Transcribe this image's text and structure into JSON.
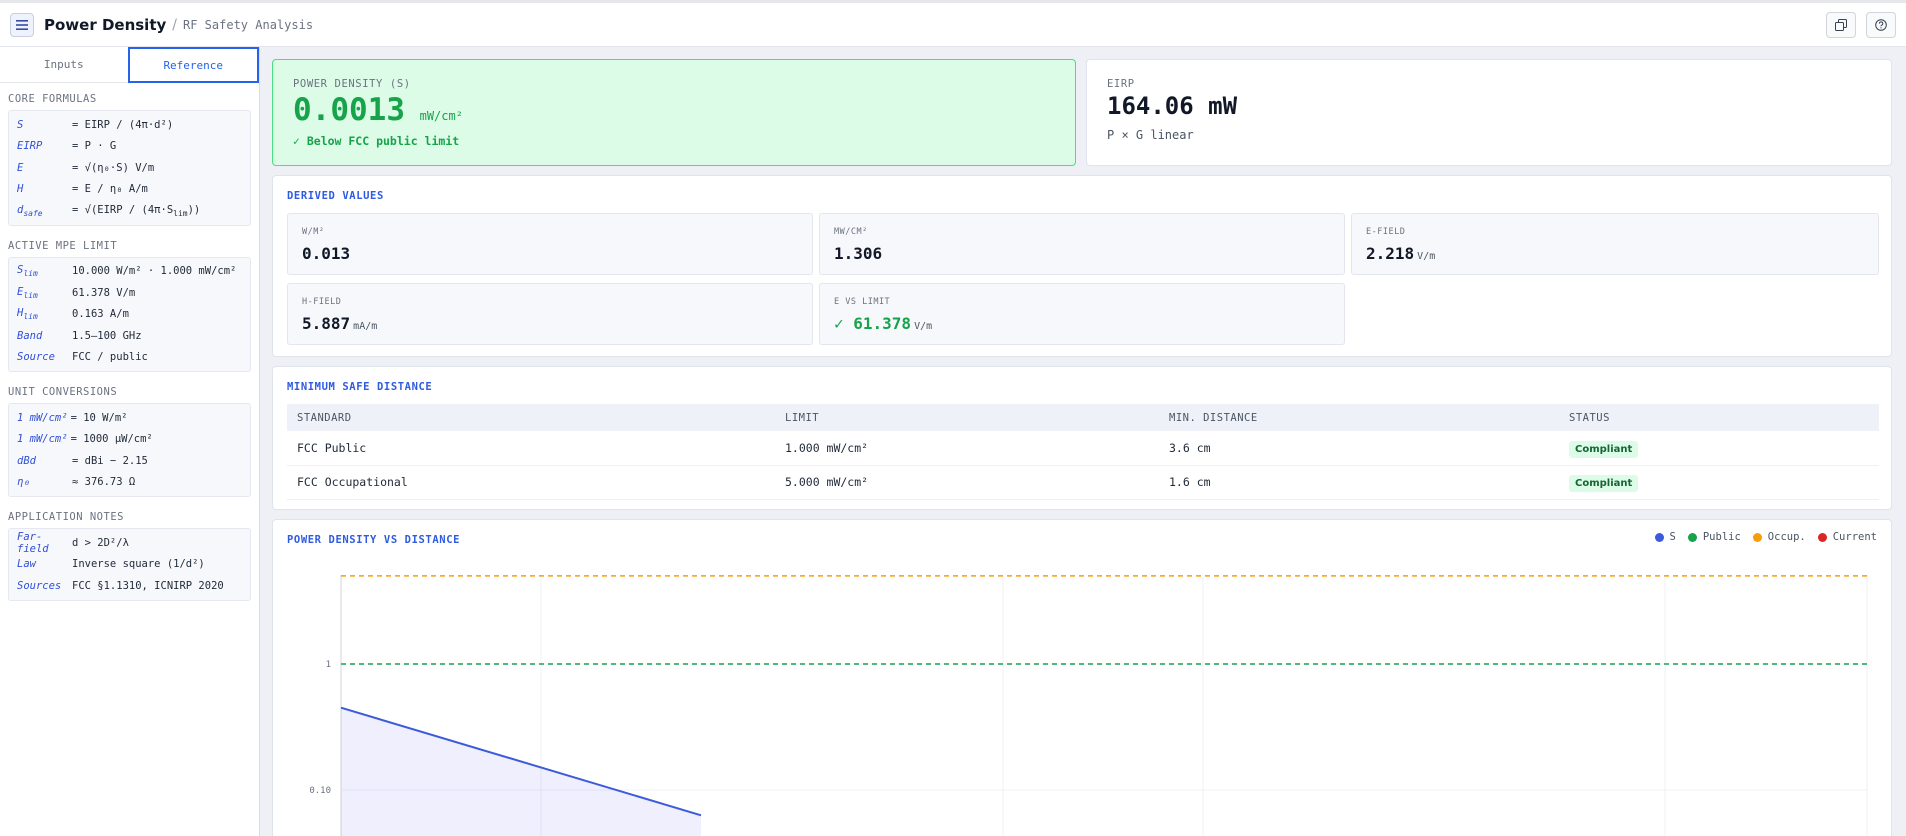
{
  "header": {
    "title": "Power Density",
    "separator": "/",
    "subtitle": "RF Safety Analysis"
  },
  "sidebar": {
    "tabs": [
      {
        "label": "Inputs",
        "active": false
      },
      {
        "label": "Reference",
        "active": true
      }
    ],
    "core_formulas": {
      "title": "CORE FORMULAS",
      "rows": [
        {
          "k": "S",
          "v": "= EIRP / (4π·d²)"
        },
        {
          "k": "EIRP",
          "v": "= P · G"
        },
        {
          "k": "E",
          "v": "= √(η₀·S) V/m"
        },
        {
          "k": "H",
          "v": "= E / η₀ A/m"
        },
        {
          "k_main": "d",
          "k_sub": "safe",
          "v_main": "= √(EIRP / (4π·S",
          "v_sub": "lim",
          "v_end": "))"
        }
      ]
    },
    "mpe_limit": {
      "title": "ACTIVE MPE LIMIT",
      "rows": [
        {
          "k_main": "S",
          "k_sub": "lim",
          "v": "10.000 W/m² · 1.000 mW/cm²"
        },
        {
          "k_main": "E",
          "k_sub": "lim",
          "v": "61.378 V/m"
        },
        {
          "k_main": "H",
          "k_sub": "lim",
          "v": "0.163 A/m"
        },
        {
          "k": "Band",
          "v": "1.5–100 GHz"
        },
        {
          "k": "Source",
          "v": "FCC / public"
        }
      ]
    },
    "conversions": {
      "title": "UNIT CONVERSIONS",
      "rows": [
        {
          "k": "1 mW/cm²",
          "v": "= 10 W/m²"
        },
        {
          "k": "1 mW/cm²",
          "v": "= 1000 µW/cm²"
        },
        {
          "k": "dBd",
          "v": "= dBi − 2.15"
        },
        {
          "k": "η₀",
          "v": "≈ 376.73 Ω"
        }
      ]
    },
    "notes": {
      "title": "APPLICATION NOTES",
      "rows": [
        {
          "k": "Far-field",
          "v": "d > 2D²/λ"
        },
        {
          "k": "Law",
          "v": "Inverse square (1/d²)"
        },
        {
          "k": "Sources",
          "v": "FCC §1.1310, ICNIRP 2020"
        }
      ]
    }
  },
  "power_density": {
    "label": "POWER DENSITY (S)",
    "value": "0.0013",
    "unit": "mW/cm²",
    "status": "✓ Below FCC public limit"
  },
  "eirp": {
    "label": "EIRP",
    "value": "164.06 mW",
    "note": "P × G linear"
  },
  "derived": {
    "title": "DERIVED VALUES",
    "items": [
      {
        "label": "W/M²",
        "value": "0.013",
        "unit": ""
      },
      {
        "label": "MW/CM²",
        "value": "1.306",
        "unit": ""
      },
      {
        "label": "E-FIELD",
        "value": "2.218",
        "unit": "V/m"
      },
      {
        "label": "H-FIELD",
        "value": "5.887",
        "unit": "mA/m"
      },
      {
        "label": "E VS LIMIT",
        "value": "✓ 61.378",
        "unit": "V/m"
      }
    ]
  },
  "min_distance": {
    "title": "MINIMUM SAFE DISTANCE",
    "headers": [
      "STANDARD",
      "LIMIT",
      "MIN. DISTANCE",
      "STATUS"
    ],
    "rows": [
      {
        "standard": "FCC Public",
        "limit": "1.000 mW/cm²",
        "distance": "3.6 cm",
        "status": "Compliant"
      },
      {
        "standard": "FCC Occupational",
        "limit": "5.000 mW/cm²",
        "distance": "1.6 cm",
        "status": "Compliant"
      }
    ]
  },
  "chart": {
    "title": "POWER DENSITY VS DISTANCE",
    "legend": [
      {
        "label": "S",
        "color": "#3b5bdb"
      },
      {
        "label": "Public",
        "color": "#16a34a"
      },
      {
        "label": "Occup.",
        "color": "#f59e0b"
      },
      {
        "label": "Current",
        "color": "#dc2626"
      }
    ]
  },
  "chart_data": {
    "type": "line",
    "y_scale": "log",
    "y_ticks": [
      "1",
      "0.10"
    ],
    "series": [
      {
        "name": "S",
        "color": "#3b5bdb",
        "style": "solid",
        "fill": true,
        "y_start": 0.45,
        "y_end_visible": 0.063
      },
      {
        "name": "Public",
        "color": "#16a34a",
        "style": "dashed",
        "value": 1
      },
      {
        "name": "Occup.",
        "color": "#f59e0b",
        "style": "dashed",
        "value": 5
      }
    ]
  }
}
